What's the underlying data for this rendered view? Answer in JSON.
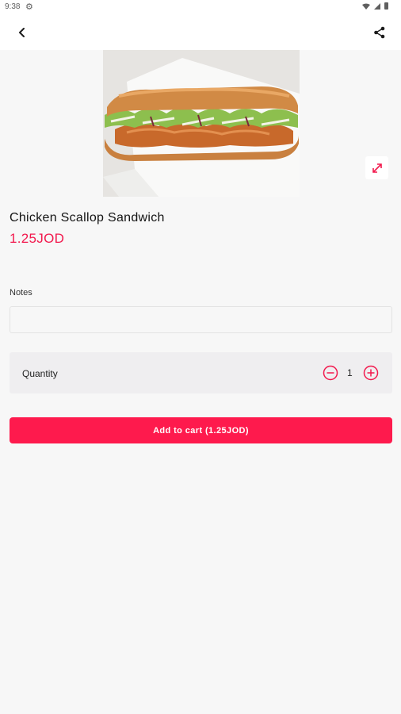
{
  "status_bar": {
    "time": "9:38"
  },
  "product": {
    "title": "Chicken Scallop Sandwich",
    "price": "1.25JOD"
  },
  "notes": {
    "label": "Notes",
    "value": "",
    "placeholder": ""
  },
  "quantity": {
    "label": "Quantity",
    "value": "1"
  },
  "cart": {
    "button_label": "Add to cart (1.25JOD)"
  },
  "colors": {
    "accent": "#fe1a4d",
    "price": "#f2194d",
    "background": "#f7f7f7"
  },
  "icons": {
    "back": "back-arrow-icon",
    "share": "share-icon",
    "expand": "expand-icon",
    "minus": "minus-circle-icon",
    "plus": "plus-circle-icon"
  }
}
